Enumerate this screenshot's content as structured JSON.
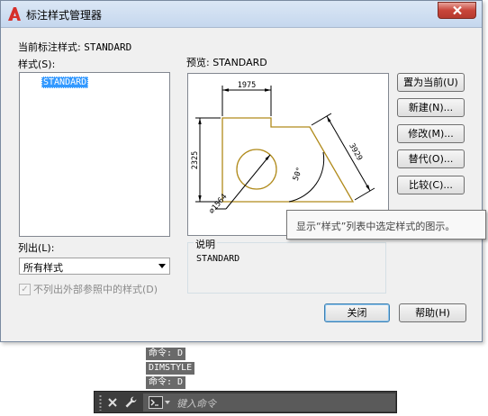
{
  "window": {
    "title": "标注样式管理器"
  },
  "current_style": {
    "label": "当前标注样式:",
    "value": "STANDARD"
  },
  "styles": {
    "label": "样式(S):",
    "items": [
      "STANDARD"
    ]
  },
  "list": {
    "label": "列出(L):",
    "selected": "所有样式"
  },
  "xref_checkbox": {
    "label": "不列出外部参照中的样式(D)",
    "checked": true,
    "enabled": false
  },
  "preview": {
    "label": "预览: STANDARD",
    "dimensions": {
      "top": "1975",
      "left": "2325",
      "diagonal": "3929",
      "angle": "50°",
      "diameter": "⌀1564"
    }
  },
  "buttons": {
    "set_current": "置为当前(U)",
    "new": "新建(N)...",
    "modify": "修改(M)...",
    "override": "替代(O)...",
    "compare": "比较(C)...",
    "close": "关闭",
    "help": "帮助(H)"
  },
  "description": {
    "label": "说明",
    "text": "STANDARD"
  },
  "tooltip": {
    "text": "显示“样式”列表中选定样式的图示。"
  },
  "command_history": [
    "命令: D",
    "DIMSTYLE",
    "命令: D"
  ],
  "command_bar": {
    "placeholder": "键入命令"
  },
  "colors": {
    "preview_geometry": "#b08a1a",
    "selection": "#3399ff",
    "close_button": "#c8453a"
  }
}
